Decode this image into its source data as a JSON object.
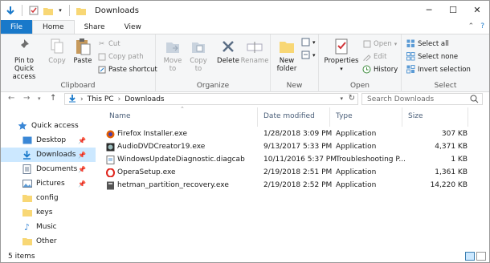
{
  "window": {
    "title": "Downloads"
  },
  "tabs": [
    "File",
    "Home",
    "Share",
    "View"
  ],
  "ribbon": {
    "clipboard": {
      "label": "Clipboard",
      "pin": "Pin to Quick\naccess",
      "copy": "Copy",
      "paste": "Paste",
      "cut": "Cut",
      "copy_path": "Copy path",
      "paste_shortcut": "Paste shortcut"
    },
    "organize": {
      "label": "Organize",
      "move_to": "Move\nto",
      "copy_to": "Copy\nto",
      "delete": "Delete",
      "rename": "Rename"
    },
    "new": {
      "label": "New",
      "new_folder": "New\nfolder"
    },
    "open": {
      "label": "Open",
      "properties": "Properties",
      "open": "Open",
      "edit": "Edit",
      "history": "History"
    },
    "select": {
      "label": "Select",
      "select_all": "Select all",
      "select_none": "Select none",
      "invert": "Invert selection"
    }
  },
  "address": {
    "parts": [
      "This PC",
      "Downloads"
    ]
  },
  "search": {
    "placeholder": "Search Downloads"
  },
  "nav": {
    "items": [
      {
        "label": "Quick access",
        "icon": "star-icon"
      },
      {
        "label": "Desktop",
        "icon": "desktop-icon"
      },
      {
        "label": "Downloads",
        "icon": "download-icon"
      },
      {
        "label": "Documents",
        "icon": "documents-icon"
      },
      {
        "label": "Pictures",
        "icon": "pictures-icon"
      },
      {
        "label": "config",
        "icon": "folder-icon"
      },
      {
        "label": "keys",
        "icon": "folder-icon"
      },
      {
        "label": "Music",
        "icon": "music-icon"
      },
      {
        "label": "Other",
        "icon": "folder-icon"
      }
    ]
  },
  "columns": [
    "Name",
    "Date modified",
    "Type",
    "Size"
  ],
  "files": [
    {
      "name": "Firefox Installer.exe",
      "date": "1/28/2018 3:09 PM",
      "type": "Application",
      "size": "307 KB"
    },
    {
      "name": "AudioDVDCreator19.exe",
      "date": "9/13/2017 5:33 PM",
      "type": "Application",
      "size": "4,371 KB"
    },
    {
      "name": "WindowsUpdateDiagnostic.diagcab",
      "date": "10/11/2016 5:37 PM",
      "type": "Troubleshooting P...",
      "size": "1 KB"
    },
    {
      "name": "OperaSetup.exe",
      "date": "2/19/2018 2:51 PM",
      "type": "Application",
      "size": "1,361 KB"
    },
    {
      "name": "hetman_partition_recovery.exe",
      "date": "2/19/2018 2:52 PM",
      "type": "Application",
      "size": "14,220 KB"
    }
  ],
  "status": {
    "count": "5 items"
  },
  "colors": {
    "accent": "#1979ca",
    "selection": "#cce8ff"
  }
}
